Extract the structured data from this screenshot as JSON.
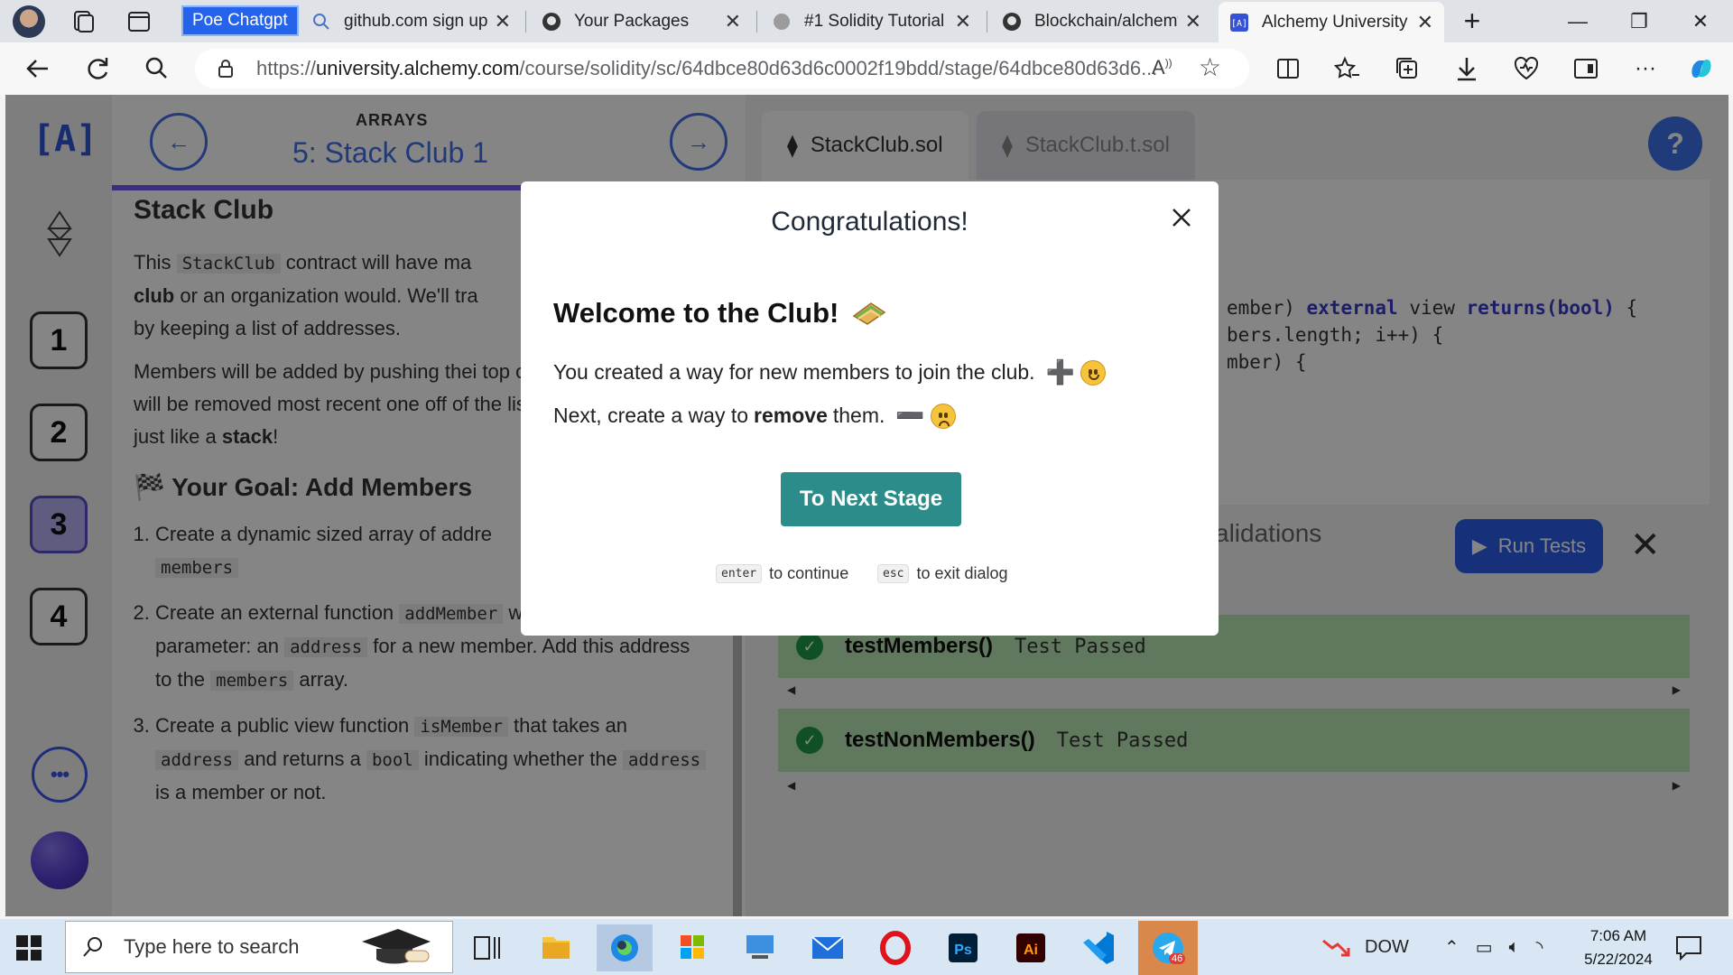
{
  "browser": {
    "pinned_tab_label": "Poe Chatgpt",
    "tabs": [
      {
        "label": "github.com sign up",
        "icon": "search-icon"
      },
      {
        "label": "Your Packages",
        "icon": "github-icon"
      },
      {
        "label": "#1 Solidity Tutorial",
        "icon": "site-icon"
      },
      {
        "label": "Blockchain/alchemy",
        "icon": "github-icon"
      },
      {
        "label": "Alchemy University",
        "icon": "alchemy-icon"
      }
    ],
    "url_prefix": "https://",
    "url_host": "university.alchemy.com",
    "url_path": "/course/solidity/sc/64dbce80d63d6c0002f19bdd/stage/64dbce80d63d6..."
  },
  "lesson": {
    "section": "ARRAYS",
    "title": "5: Stack Club 1",
    "stages": [
      "1",
      "2",
      "3",
      "4"
    ],
    "current_stage": "3",
    "heading": "Stack Club",
    "para1_a": "This",
    "para1_code": "StackClub",
    "para1_b": "contract will have ma",
    "para1_c": "club",
    "para1_d": "or an organization would. We'll tra",
    "para1_e": "by keeping a list of addresses.",
    "para2": "Members will be added by pushing thei top of the list. Members will be removed most recent one off of the list. A Last-In structure, just like a",
    "para2_bold": "stack",
    "goal_heading": "Your Goal: Add Members",
    "goal1_a": "Create a dynamic sized array of addre",
    "goal1_code": "members",
    "goal2_a": "Create an external function",
    "goal2_code1": "addMember",
    "goal2_b": "which has a single parameter: an",
    "goal2_code2": "address",
    "goal2_c": "for a new member. Add this address to the",
    "goal2_code3": "members",
    "goal2_d": "array.",
    "goal3_a": "Create a public view function",
    "goal3_code1": "isMember",
    "goal3_b": "that takes an",
    "goal3_code2": "address",
    "goal3_c": "and returns a",
    "goal3_code3": "bool",
    "goal3_d": "indicating whether the",
    "goal3_code4": "address",
    "goal3_e": "is a member or not."
  },
  "editor": {
    "tabs": [
      "StackClub.sol",
      "StackClub.t.sol"
    ],
    "code_line1_a": "ember) ",
    "code_line1_kw1": "external",
    "code_line1_b": " view ",
    "code_line1_kw2": "returns(bool)",
    "code_line1_c": " {",
    "code_line2": "bers.length; i++) {",
    "code_line3": "mber) {",
    "validations_label": "alidations",
    "run_label": "Run Tests",
    "tests": [
      {
        "name": "testMembers()",
        "result": "Test Passed"
      },
      {
        "name": "testNonMembers()",
        "result": "Test Passed"
      }
    ]
  },
  "modal": {
    "title": "Congratulations!",
    "heading": "Welcome to the Club!",
    "line1": "You created a way for new members to join the club.",
    "line1_glyph": "➕",
    "line2_a": "Next, create a way to",
    "line2_bold": "remove",
    "line2_b": "them.",
    "line2_glyph": "➖",
    "button": "To Next Stage",
    "hint_enter_key": "enter",
    "hint_enter_text": "to continue",
    "hint_esc_key": "esc",
    "hint_esc_text": "to exit dialog"
  },
  "taskbar": {
    "search_placeholder": "Type here to search",
    "ticker": "DOW",
    "time": "7:06 AM",
    "date": "5/22/2024",
    "telegram_badge": "46"
  },
  "colors": {
    "modal_button": "#2c8c8a",
    "link_blue": "#3f6ee8",
    "accent_purple": "#6d5df0",
    "test_pass_bg": "#b8e6b2"
  }
}
